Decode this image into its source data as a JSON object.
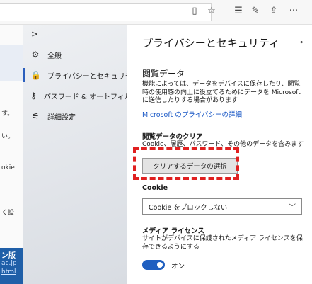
{
  "toolbar": {
    "icons": [
      "reading-view-icon",
      "favorite-star-icon",
      "favorites-list-icon",
      "pen-icon",
      "share-icon",
      "more-icon"
    ],
    "more_label": "···"
  },
  "page_fragments": {
    "line1": "す。",
    "line2": "い。",
    "line3": "okie",
    "line4": "く設",
    "banner_text": "ン版",
    "banner_link1": "ac.jp",
    "banner_link2": "html"
  },
  "nav": {
    "items": [
      {
        "label": "全般",
        "icon": "gear-icon",
        "glyph": "⚙"
      },
      {
        "label": "プライバシーとセキュリティ",
        "icon": "lock-icon",
        "glyph": "🔒"
      },
      {
        "label": "パスワード & オートフィル",
        "icon": "key-icon",
        "glyph": "⚷"
      },
      {
        "label": "詳細設定",
        "icon": "sliders-icon",
        "glyph": "⚟"
      }
    ],
    "active_index": 1
  },
  "detail": {
    "title": "プライバシーとセキュリティ",
    "browsing_data": {
      "heading": "閲覧データ",
      "description": "機能によっては、データをデバイスに保存したり、閲覧時の使用感の向上に役立てるためにデータを Microsoft に送信したりする場合があります",
      "link": "Microsoft のプライバシーの詳細"
    },
    "clear_data": {
      "heading": "閲覧データのクリア",
      "description": "Cookie、履歴、パスワード、その他のデータを含みます",
      "button": "クリアするデータの選択"
    },
    "cookie": {
      "heading": "Cookie",
      "selected": "Cookie をブロックしない"
    },
    "media_license": {
      "heading": "メディア ライセンス",
      "description": "サイトがデバイスに保護されたメディア ライセンスを保存できるようにする",
      "toggle_state": "オン"
    }
  },
  "colors": {
    "accent": "#1f5fc0",
    "highlight": "#e02020",
    "link": "#1756c5"
  }
}
